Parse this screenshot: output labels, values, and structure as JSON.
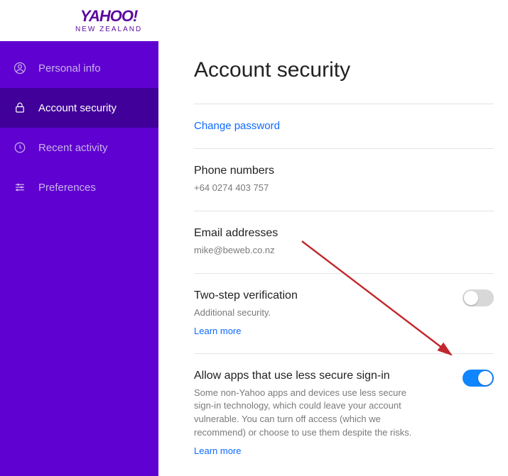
{
  "logo": {
    "main": "YAHOO",
    "bang": "!",
    "sub": "NEW ZEALAND"
  },
  "sidebar": {
    "items": [
      {
        "label": "Personal info"
      },
      {
        "label": "Account security"
      },
      {
        "label": "Recent activity"
      },
      {
        "label": "Preferences"
      }
    ]
  },
  "page": {
    "title": "Account security",
    "change_password": "Change password",
    "phone": {
      "title": "Phone numbers",
      "value": "+64 0274 403 757"
    },
    "email": {
      "title": "Email addresses",
      "value": "mike@beweb.co.nz"
    },
    "twostep": {
      "title": "Two-step verification",
      "sub": "Additional security.",
      "learn": "Learn more"
    },
    "less_secure": {
      "title": "Allow apps that use less secure sign-in",
      "sub": "Some non-Yahoo apps and devices use less secure sign-in technology, which could leave your account vulnerable. You can turn off access (which we recommend) or choose to use them despite the risks.",
      "learn": "Learn more"
    }
  }
}
